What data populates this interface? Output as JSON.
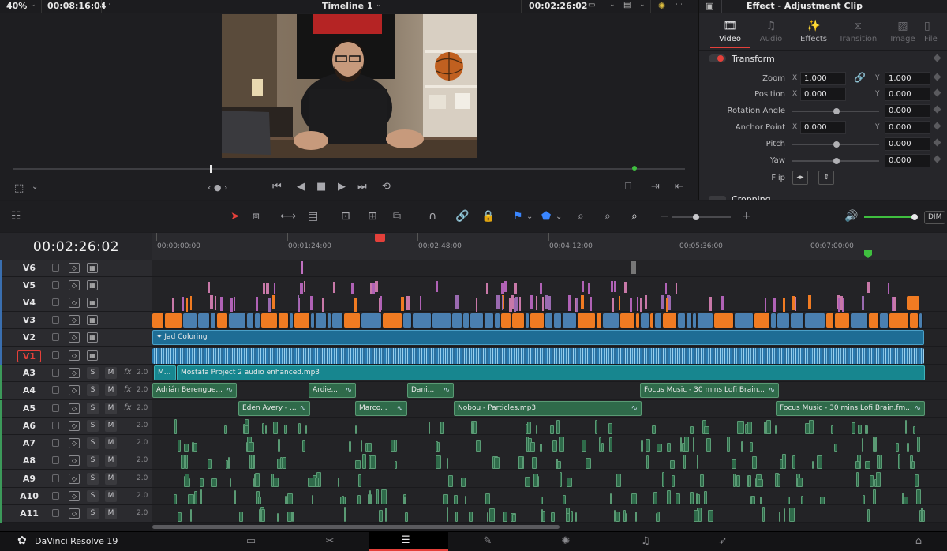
{
  "viewer": {
    "zoom": "40%",
    "source_timecode": "00:08:16:04",
    "timeline_name": "Timeline 1",
    "record_timecode": "00:02:26:02"
  },
  "inspector": {
    "title": "Effect - Adjustment Clip",
    "tabs": [
      {
        "label": "Video",
        "icon": "video-icon"
      },
      {
        "label": "Audio",
        "icon": "audio-icon"
      },
      {
        "label": "Effects",
        "icon": "effects-icon"
      },
      {
        "label": "Transition",
        "icon": "transition-icon"
      },
      {
        "label": "Image",
        "icon": "image-icon"
      },
      {
        "label": "File",
        "icon": "file-icon"
      }
    ],
    "section": "Transform",
    "next_section": "Cropping",
    "zoom": {
      "label": "Zoom",
      "x": "1.000",
      "y": "1.000"
    },
    "position": {
      "label": "Position",
      "x": "0.000",
      "y": "0.000"
    },
    "rotation": {
      "label": "Rotation Angle",
      "value": "0.000"
    },
    "anchor": {
      "label": "Anchor Point",
      "x": "0.000",
      "y": "0.000"
    },
    "pitch": {
      "label": "Pitch",
      "value": "0.000"
    },
    "yaw": {
      "label": "Yaw",
      "value": "0.000"
    },
    "flip": {
      "label": "Flip"
    },
    "axis_x": "X",
    "axis_y": "Y"
  },
  "toolbar": {
    "dim_label": "DIM",
    "zoom_minus": "−",
    "zoom_plus": "+"
  },
  "timeline": {
    "timecode": "00:02:26:02",
    "ruler": [
      "00:00:00:00",
      "00:01:24:00",
      "00:02:48:00",
      "00:04:12:00",
      "00:05:36:00",
      "00:07:00:00"
    ],
    "video_tracks": [
      "V6",
      "V5",
      "V4",
      "V3",
      "V2",
      "V1"
    ],
    "audio_tracks": [
      {
        "name": "A3",
        "fx": "fx",
        "vol": "2.0"
      },
      {
        "name": "A4",
        "fx": "fx",
        "vol": "2.0"
      },
      {
        "name": "A5",
        "fx": "fx",
        "vol": "2.0"
      },
      {
        "name": "A6",
        "fx": "",
        "vol": "2.0"
      },
      {
        "name": "A7",
        "fx": "",
        "vol": "2.0"
      },
      {
        "name": "A8",
        "fx": "",
        "vol": "2.0"
      },
      {
        "name": "A9",
        "fx": "",
        "vol": "2.0"
      },
      {
        "name": "A10",
        "fx": "",
        "vol": "2.0"
      },
      {
        "name": "A11",
        "fx": "",
        "vol": "2.0"
      }
    ],
    "solo_label": "S",
    "mute_label": "M",
    "v2_clip": "Jad Coloring",
    "a3_clips": [
      "M...",
      "Mostafa Project 2 audio enhanced.mp3"
    ],
    "a4_clips": [
      "Adrián Berengue...",
      "Ardie...",
      "Dani...",
      "Focus Music - 30 mins Lofi Brain..."
    ],
    "a5_clips": [
      "Eden Avery - ...",
      "Marco...",
      "Nobou - Particles.mp3",
      "Focus Music - 30 mins Lofi Brain.fm..."
    ]
  },
  "app": {
    "name": "DaVinci Resolve 19",
    "pages": [
      "media-icon",
      "cut-icon",
      "edit-icon",
      "fusion-icon",
      "color-icon",
      "fairlight-icon",
      "deliver-icon"
    ],
    "active_page": "edit-icon"
  },
  "colors": {
    "playhead": "#e4403a",
    "accent": "#17868f",
    "audio_clip": "#2f6a4a",
    "video_orange": "#f07b22",
    "video_blue": "#4a7fb0",
    "marker_green": "#3fbf3f"
  }
}
